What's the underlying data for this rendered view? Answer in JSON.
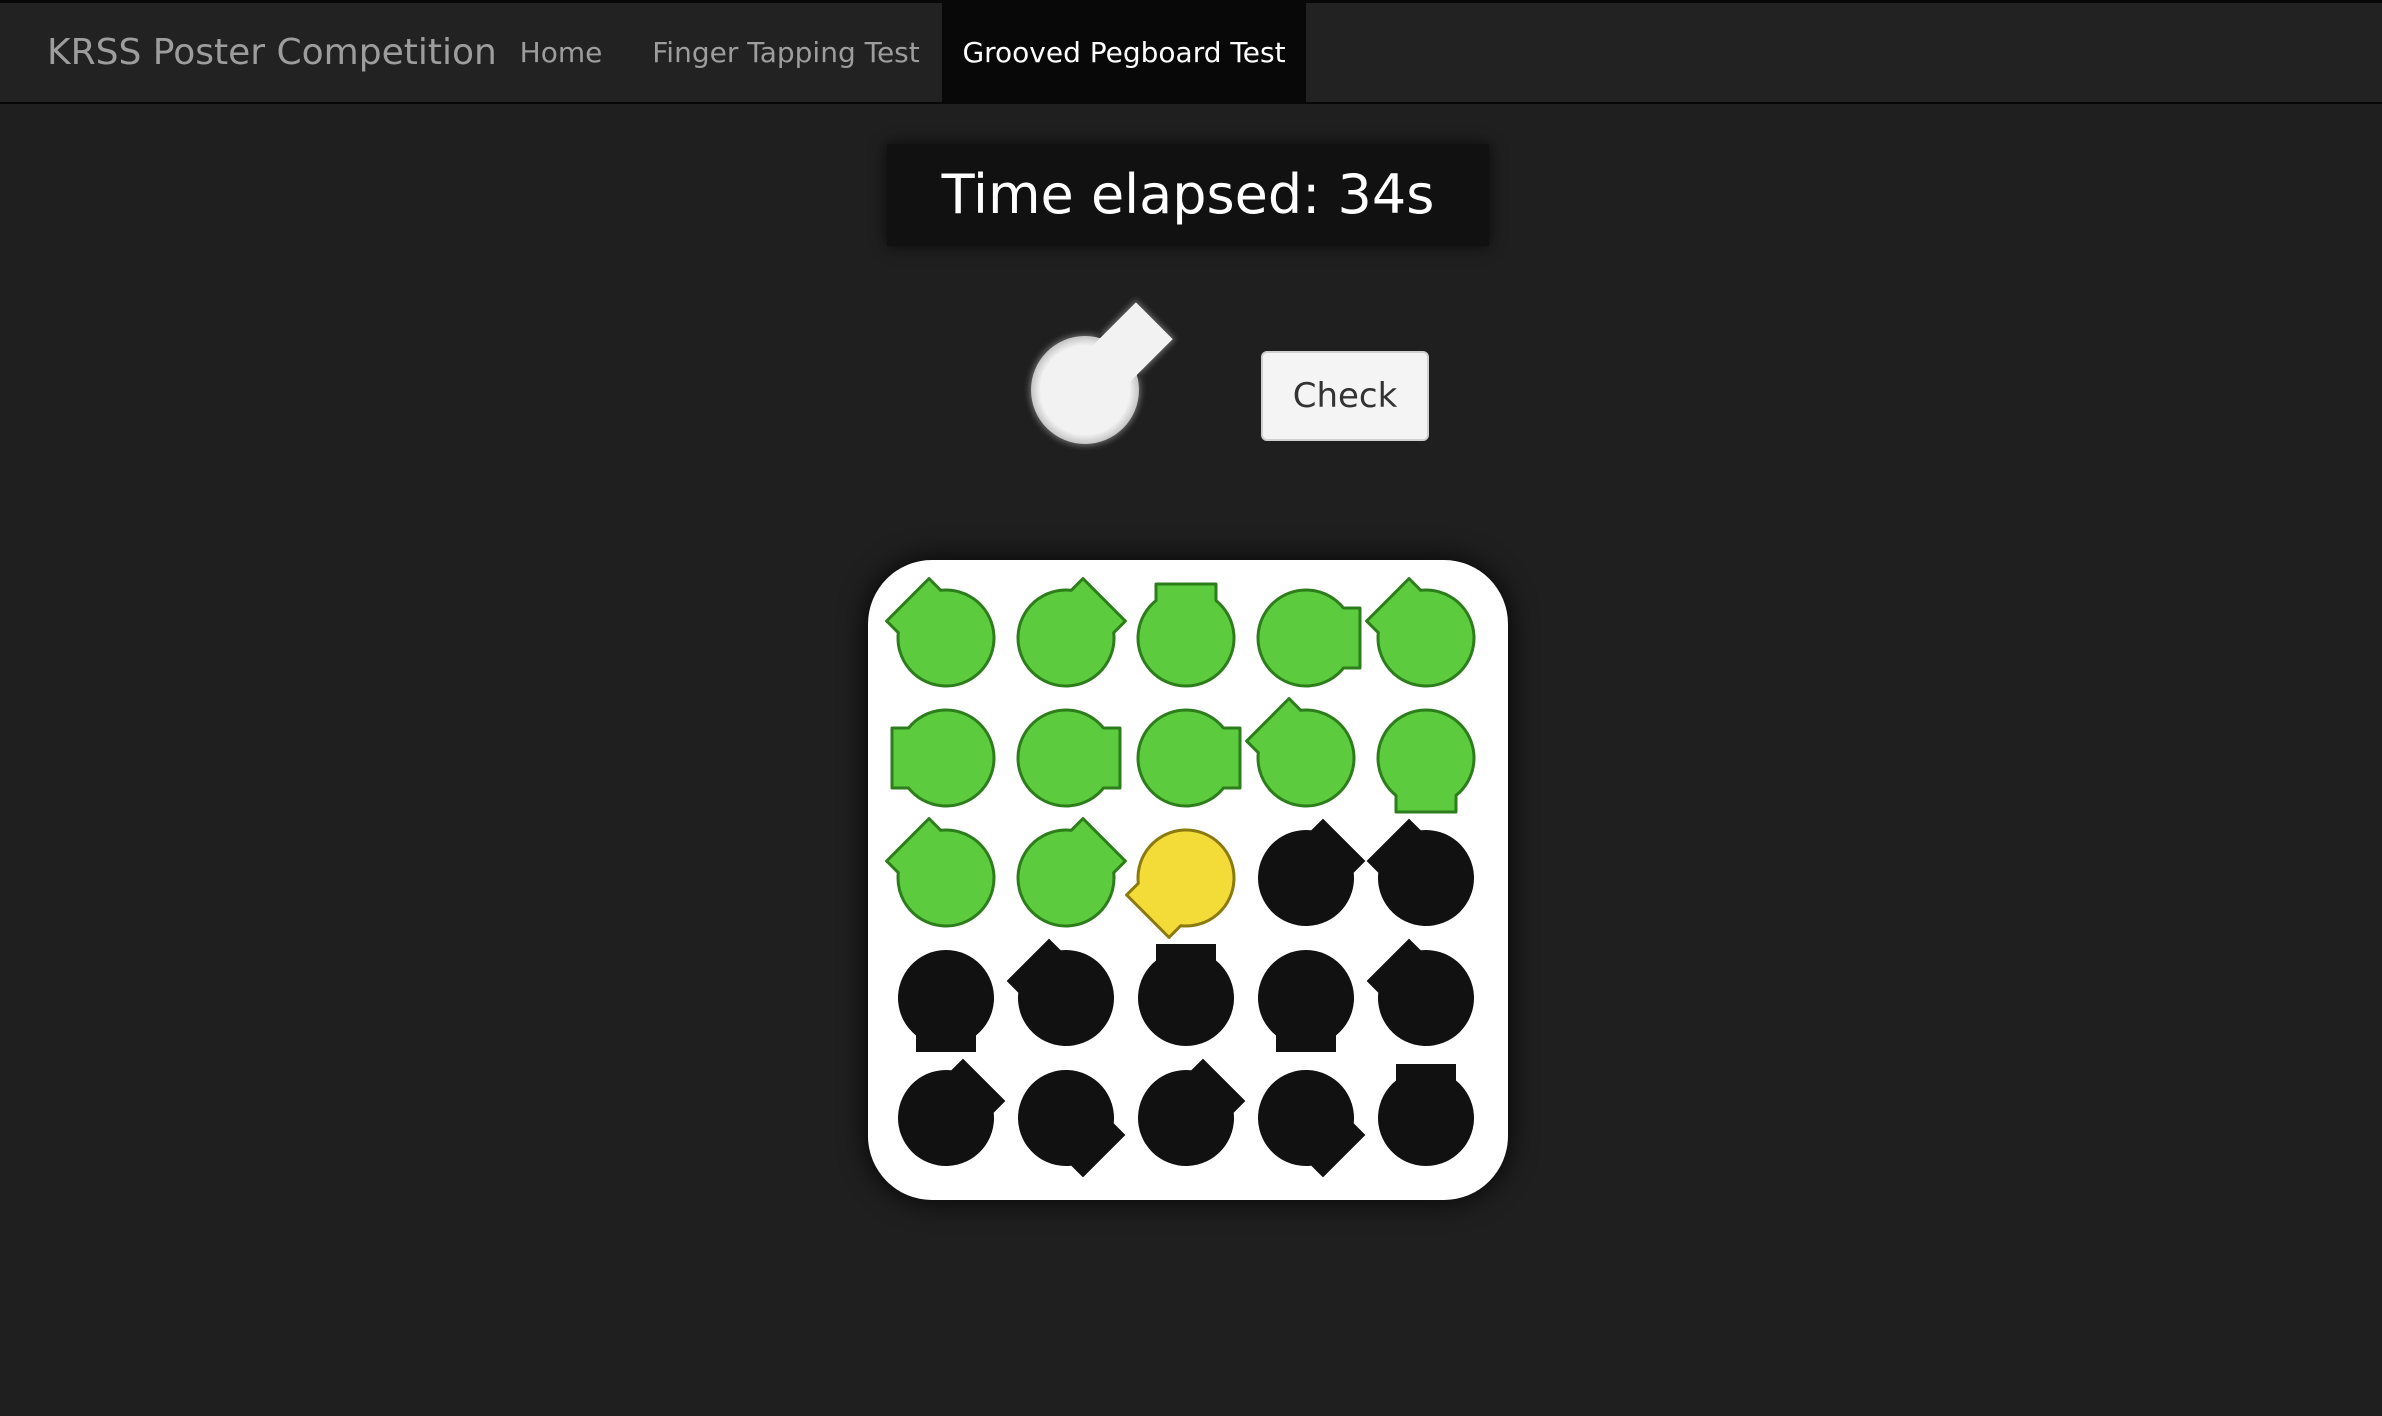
{
  "navbar": {
    "brand": "KRSS Poster Competition",
    "items": [
      {
        "label": "Home",
        "active": false
      },
      {
        "label": "Finger Tapping Test",
        "active": false
      },
      {
        "label": "Grooved Pegboard Test",
        "active": true
      }
    ]
  },
  "timer": {
    "text": "Time elapsed: 34s"
  },
  "current_peg": {
    "icon": "keyhole-peg-icon",
    "color": "#f2f2f2",
    "rotation_deg": 45
  },
  "check_button": {
    "label": "Check"
  },
  "colors": {
    "background": "#1f1f1f",
    "navbar": "#222222",
    "navbar_active": "#080808",
    "placed_fill": "#5ccb3e",
    "placed_stroke": "#2e7d1c",
    "current_fill": "#f3dc38",
    "current_stroke": "#8a7a10",
    "empty_fill": "#111111"
  },
  "pegboard": {
    "rows": 5,
    "cols": 5,
    "holes": [
      {
        "state": "placed",
        "rotation_deg": 135
      },
      {
        "state": "placed",
        "rotation_deg": 45
      },
      {
        "state": "placed",
        "rotation_deg": 90
      },
      {
        "state": "placed",
        "rotation_deg": 0
      },
      {
        "state": "placed",
        "rotation_deg": 135
      },
      {
        "state": "placed",
        "rotation_deg": 180
      },
      {
        "state": "placed",
        "rotation_deg": 0
      },
      {
        "state": "placed",
        "rotation_deg": 0
      },
      {
        "state": "placed",
        "rotation_deg": 135
      },
      {
        "state": "placed",
        "rotation_deg": 270
      },
      {
        "state": "placed",
        "rotation_deg": 135
      },
      {
        "state": "placed",
        "rotation_deg": 45
      },
      {
        "state": "current",
        "rotation_deg": 225
      },
      {
        "state": "empty",
        "rotation_deg": 45
      },
      {
        "state": "empty",
        "rotation_deg": 135
      },
      {
        "state": "empty",
        "rotation_deg": 270
      },
      {
        "state": "empty",
        "rotation_deg": 135
      },
      {
        "state": "empty",
        "rotation_deg": 90
      },
      {
        "state": "empty",
        "rotation_deg": 270
      },
      {
        "state": "empty",
        "rotation_deg": 135
      },
      {
        "state": "empty",
        "rotation_deg": 45
      },
      {
        "state": "empty",
        "rotation_deg": 315
      },
      {
        "state": "empty",
        "rotation_deg": 45
      },
      {
        "state": "empty",
        "rotation_deg": 315
      },
      {
        "state": "empty",
        "rotation_deg": 90
      }
    ]
  }
}
